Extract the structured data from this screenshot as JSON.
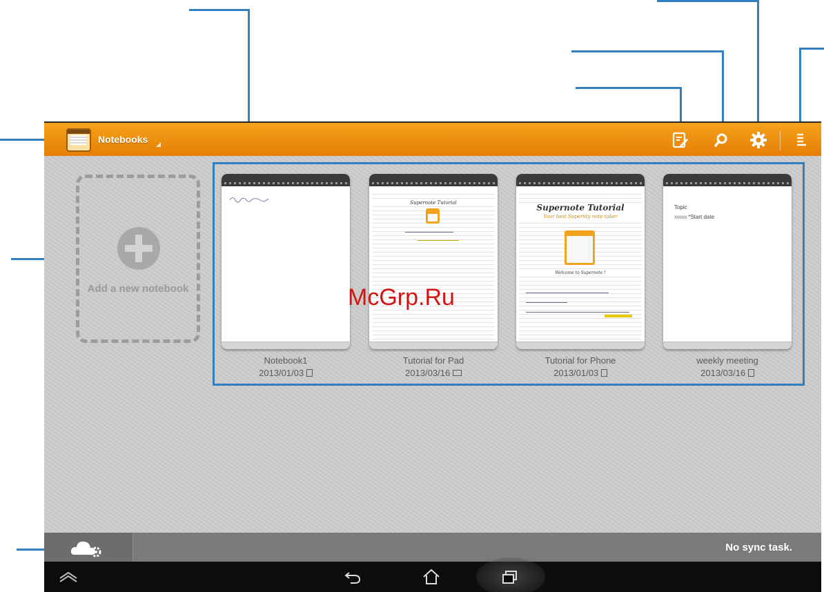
{
  "action_bar": {
    "title": "Notebooks",
    "icons": [
      "notebooks-app-icon",
      "edit-page-icon",
      "search-icon",
      "settings-gear-icon",
      "menu-icon"
    ]
  },
  "add_notebook": {
    "label": "Add a new notebook"
  },
  "notebooks": [
    {
      "name": "Notebook1",
      "date": "2013/01/03",
      "format_icon": "portrait-page-icon"
    },
    {
      "name": "Tutorial for Pad",
      "date": "2013/03/16",
      "format_icon": "landscape-page-icon"
    },
    {
      "name": "Tutorial for Phone",
      "date": "2013/01/03",
      "format_icon": "portrait-page-icon"
    },
    {
      "name": "weekly meeting",
      "date": "2013/03/16",
      "format_icon": "portrait-page-icon"
    }
  ],
  "thumbnails": {
    "pad_title": "Supernote Tutorial",
    "phone_title": "Supernote Tutorial",
    "phone_subtitle": "Your best Superlity note taker",
    "phone_welcome": "Welcome to Supernote !",
    "meeting_topic": "Topic",
    "meeting_start": "*Start date"
  },
  "bottom_bar": {
    "sync_status": "No sync task."
  },
  "watermark": "McGrp.Ru",
  "colors": {
    "action_bar": "#e98a0c",
    "callout": "#2f7fc1",
    "background": "#cdcdcd"
  }
}
